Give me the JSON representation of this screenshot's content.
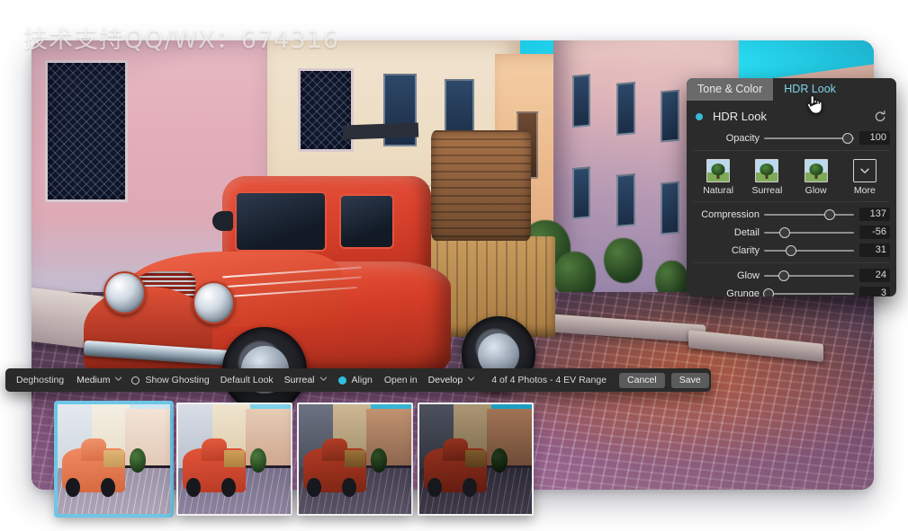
{
  "watermark": {
    "text": "技术支持QQ/WX：674316"
  },
  "photo": {
    "alt_description": "Vintage red Fiat pickup truck parked on a cobblestone street in an Italian alley, HDR processed",
    "scene_name": "hdr-merge-preview"
  },
  "panel": {
    "tabs": [
      {
        "id": "tone-color",
        "label": "Tone & Color",
        "active": false
      },
      {
        "id": "hdr-look",
        "label": "HDR Look",
        "active": true
      }
    ],
    "section_title": "HDR Look",
    "reset_tooltip": "Reset",
    "opacity": {
      "label": "Opacity",
      "value": "100",
      "percent": 93
    },
    "presets": [
      {
        "id": "natural",
        "label": "Natural"
      },
      {
        "id": "surreal",
        "label": "Surreal"
      },
      {
        "id": "glow",
        "label": "Glow"
      },
      {
        "id": "more",
        "label": "More"
      }
    ],
    "sliders": [
      {
        "id": "compression",
        "label": "Compression",
        "value": "137",
        "percent": 73
      },
      {
        "id": "detail",
        "label": "Detail",
        "value": "-56",
        "percent": 23
      },
      {
        "id": "clarity",
        "label": "Clarity",
        "value": "31",
        "percent": 30
      },
      {
        "id": "glow",
        "label": "Glow",
        "value": "24",
        "percent": 22
      },
      {
        "id": "grunge",
        "label": "Grunge",
        "value": "3",
        "percent": 5
      }
    ]
  },
  "toolbar": {
    "deghosting_label": "Deghosting",
    "deghosting_value": "Medium",
    "show_ghosting_label": "Show Ghosting",
    "show_ghosting_checked": false,
    "default_look_label": "Default Look",
    "default_look_value": "Surreal",
    "align_label": "Align",
    "align_enabled": true,
    "open_in_label": "Open in",
    "open_in_value": "Develop",
    "status": "4 of 4 Photos - 4 EV Range",
    "cancel_label": "Cancel",
    "save_label": "Save"
  },
  "filmstrip": {
    "thumbnails": [
      {
        "id": "exposure-1",
        "selected": true,
        "tone": "bright"
      },
      {
        "id": "exposure-2",
        "selected": false,
        "tone": "normal"
      },
      {
        "id": "exposure-3",
        "selected": false,
        "tone": "dark"
      },
      {
        "id": "exposure-4",
        "selected": false,
        "tone": "darkest"
      }
    ]
  },
  "colors": {
    "accent_cyan": "#2fc0de",
    "tab_active_text": "#7fd4e8",
    "panel_bg": "#2b2b2b",
    "toolbar_bg": "#2a2a2a",
    "selection_border": "#6ec6e6",
    "truck_red": "#d43d27",
    "sky_cyan": "#2fc2e4"
  },
  "cursor": {
    "type": "pointing-hand"
  }
}
